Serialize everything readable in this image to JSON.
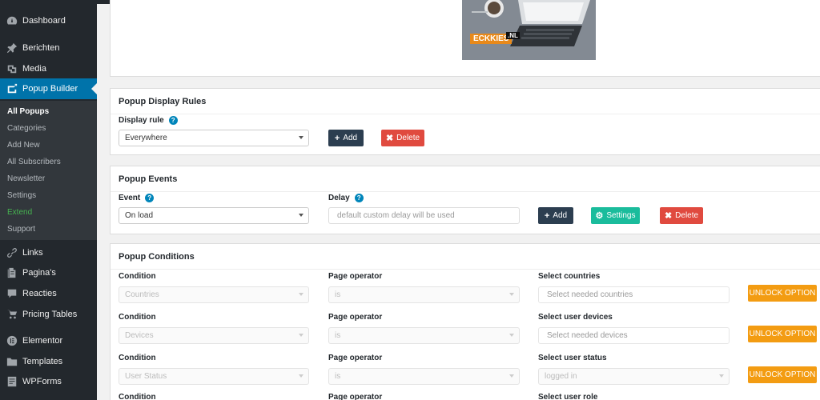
{
  "sidebar": {
    "items": [
      {
        "label": "Dashboard",
        "icon": "dashboard-icon"
      },
      {
        "label": "Berichten",
        "icon": "pin-icon"
      },
      {
        "label": "Media",
        "icon": "media-icon"
      },
      {
        "label": "Popup Builder",
        "icon": "popup-builder-icon"
      },
      {
        "label": "Links",
        "icon": "link-icon"
      },
      {
        "label": "Pagina's",
        "icon": "page-icon"
      },
      {
        "label": "Reacties",
        "icon": "comment-icon"
      },
      {
        "label": "Pricing Tables",
        "icon": "cart-icon"
      },
      {
        "label": "Elementor",
        "icon": "elementor-icon"
      },
      {
        "label": "Templates",
        "icon": "folder-icon"
      },
      {
        "label": "WPForms",
        "icon": "forms-icon"
      }
    ],
    "submenu": [
      "All Popups",
      "Categories",
      "Add New",
      "All Subscribers",
      "Newsletter",
      "Settings",
      "Extend",
      "Support"
    ]
  },
  "image": {
    "logo_text": "ECKKIES",
    "logo_suffix": ".NL"
  },
  "display_rules": {
    "title": "Popup Display Rules",
    "rule_label": "Display rule",
    "rule_value": "Everywhere",
    "add_label": "Add",
    "delete_label": "Delete"
  },
  "events": {
    "title": "Popup Events",
    "event_label": "Event",
    "event_value": "On load",
    "delay_label": "Delay",
    "delay_placeholder": "default custom delay will be used",
    "add_label": "Add",
    "settings_label": "Settings",
    "delete_label": "Delete"
  },
  "conditions": {
    "title": "Popup Conditions",
    "rows": [
      {
        "condition_label": "Condition",
        "condition_value": "Countries",
        "operator_label": "Page operator",
        "operator_value": "is",
        "third_label": "Select countries",
        "third_value": "Select needed countries",
        "unlock_label": "UNLOCK OPTION"
      },
      {
        "condition_label": "Condition",
        "condition_value": "Devices",
        "operator_label": "Page operator",
        "operator_value": "is",
        "third_label": "Select user devices",
        "third_value": "Select needed devices",
        "unlock_label": "UNLOCK OPTION"
      },
      {
        "condition_label": "Condition",
        "condition_value": "User Status",
        "operator_label": "Page operator",
        "operator_value": "is",
        "third_label": "Select user status",
        "third_value": "logged in",
        "unlock_label": "UNLOCK OPTION"
      },
      {
        "condition_label": "Condition",
        "operator_label": "Page operator",
        "third_label": "Select user role"
      }
    ]
  },
  "colors": {
    "sidebar_bg": "#23282d",
    "active_blue": "#0073aa",
    "dark_button": "#2c3e50",
    "red_button": "#e04a3f",
    "teal_button": "#1abc9c",
    "unlock_orange": "#f39c12"
  }
}
